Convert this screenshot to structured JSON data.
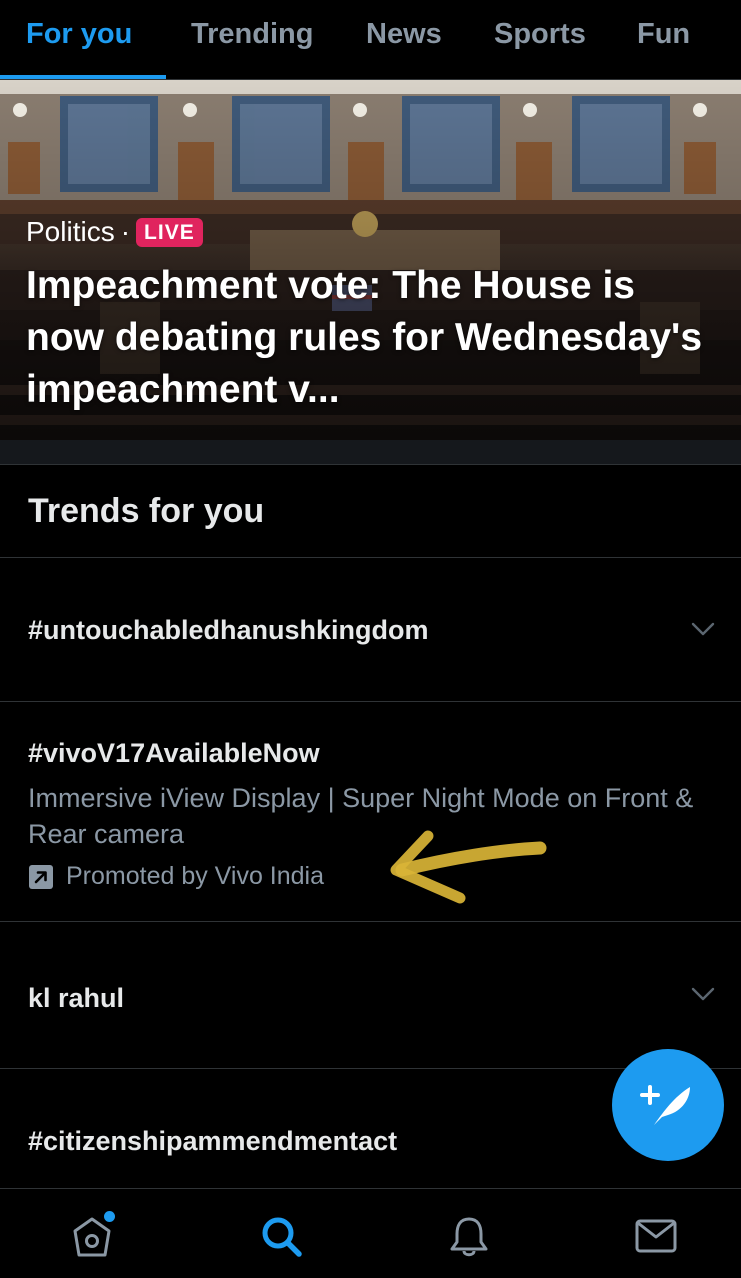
{
  "tabs": [
    {
      "label": "For you",
      "active": true
    },
    {
      "label": "Trending",
      "active": false
    },
    {
      "label": "News",
      "active": false
    },
    {
      "label": "Sports",
      "active": false
    },
    {
      "label": "Fun",
      "active": false
    }
  ],
  "hero": {
    "category": "Politics",
    "separator": "·",
    "badge": "LIVE",
    "headline": "Impeachment vote: The House is now debating rules for Wednesday's impeachment v..."
  },
  "trends": {
    "title": "Trends for you",
    "items": [
      {
        "name": "#untouchabledhanushkingdom",
        "has_menu": true
      },
      {
        "name": "#vivoV17AvailableNow",
        "description": "Immersive iView Display | Super Night Mode on Front & Rear camera",
        "promoted": "Promoted by Vivo India"
      },
      {
        "name": "kl rahul",
        "has_menu": true
      },
      {
        "name": "#citizenshipammendmentact"
      }
    ]
  },
  "fab": {
    "icon": "compose-tweet-icon"
  },
  "bottom_nav": [
    {
      "icon": "home-icon",
      "active": false,
      "has_dot": true
    },
    {
      "icon": "search-icon",
      "active": true
    },
    {
      "icon": "bell-icon",
      "active": false
    },
    {
      "icon": "mail-icon",
      "active": false
    }
  ],
  "colors": {
    "accent": "#1d9bf0",
    "live": "#e0245e",
    "background": "#000000",
    "text_secondary": "#8b98a5",
    "annotation_arrow": "#d9b436"
  }
}
